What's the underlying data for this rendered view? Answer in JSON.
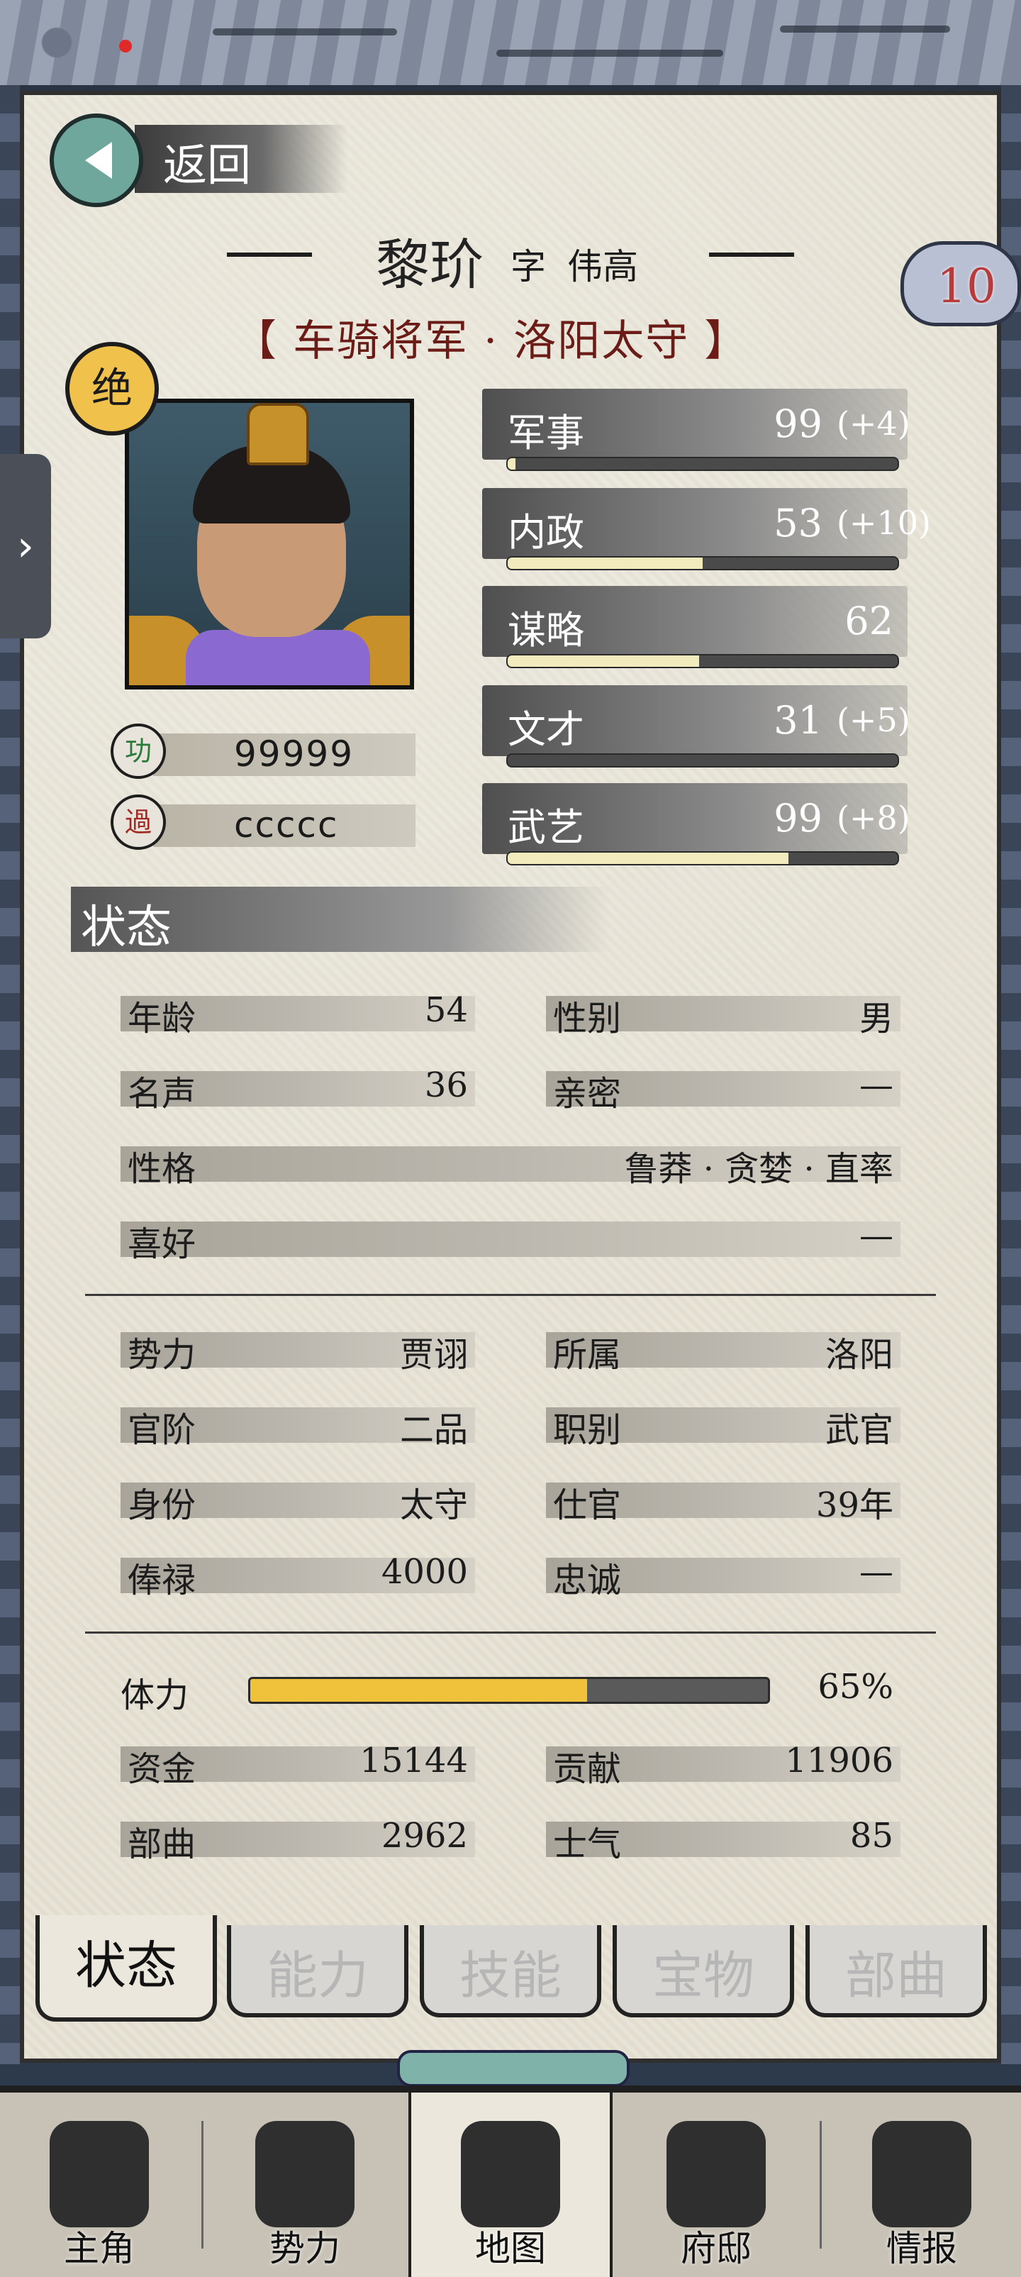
{
  "nav_back": {
    "label": "返回"
  },
  "officer": {
    "name": "黎玠",
    "courtesy_prefix": "字",
    "courtesy_name": "伟高",
    "titles": "【 车骑将军 · 洛阳太守 】",
    "level": "10",
    "grade_badge": "绝",
    "merit_label": "功",
    "demerit_label": "過",
    "merit_value": "99999",
    "demerit_value": "ccccc"
  },
  "stats": [
    {
      "label": "军事",
      "value": "99",
      "bonus": "(+4)",
      "bar_fraction": 0.02
    },
    {
      "label": "内政",
      "value": "53",
      "bonus": "(+10)",
      "bar_fraction": 0.5
    },
    {
      "label": "谋略",
      "value": "62",
      "bonus": "",
      "bar_fraction": 0.49
    },
    {
      "label": "文才",
      "value": "31",
      "bonus": "(+5)",
      "bar_fraction": 0.0
    },
    {
      "label": "武艺",
      "value": "99",
      "bonus": "(+8)",
      "bar_fraction": 0.72
    }
  ],
  "section_title": "状态",
  "status_fields": [
    {
      "key": "年龄",
      "value": "54"
    },
    {
      "key": "性别",
      "value": "男"
    },
    {
      "key": "名声",
      "value": "36"
    },
    {
      "key": "亲密",
      "value": "—"
    },
    {
      "key": "性格",
      "value": "鲁莽 · 贪婪 · 直率"
    },
    {
      "key": "喜好",
      "value": "—"
    }
  ],
  "office_fields": [
    {
      "key": "势力",
      "value": "贾诩"
    },
    {
      "key": "所属",
      "value": "洛阳"
    },
    {
      "key": "官阶",
      "value": "二品"
    },
    {
      "key": "职别",
      "value": "武官"
    },
    {
      "key": "身份",
      "value": "太守"
    },
    {
      "key": "仕官",
      "value": "39年"
    },
    {
      "key": "俸禄",
      "value": "4000"
    },
    {
      "key": "忠诚",
      "value": "—"
    }
  ],
  "stamina": {
    "key": "体力",
    "value": "65%",
    "fraction": 0.65
  },
  "resource_fields": [
    {
      "key": "资金",
      "value": "15144"
    },
    {
      "key": "贡献",
      "value": "11906"
    },
    {
      "key": "部曲",
      "value": "2962"
    },
    {
      "key": "士气",
      "value": "85"
    }
  ],
  "sub_tabs": [
    "状态",
    "能力",
    "技能",
    "宝物",
    "部曲"
  ],
  "bottom_nav": [
    "主角",
    "势力",
    "地图",
    "府邸",
    "情报"
  ],
  "drawer_toggle": "›"
}
